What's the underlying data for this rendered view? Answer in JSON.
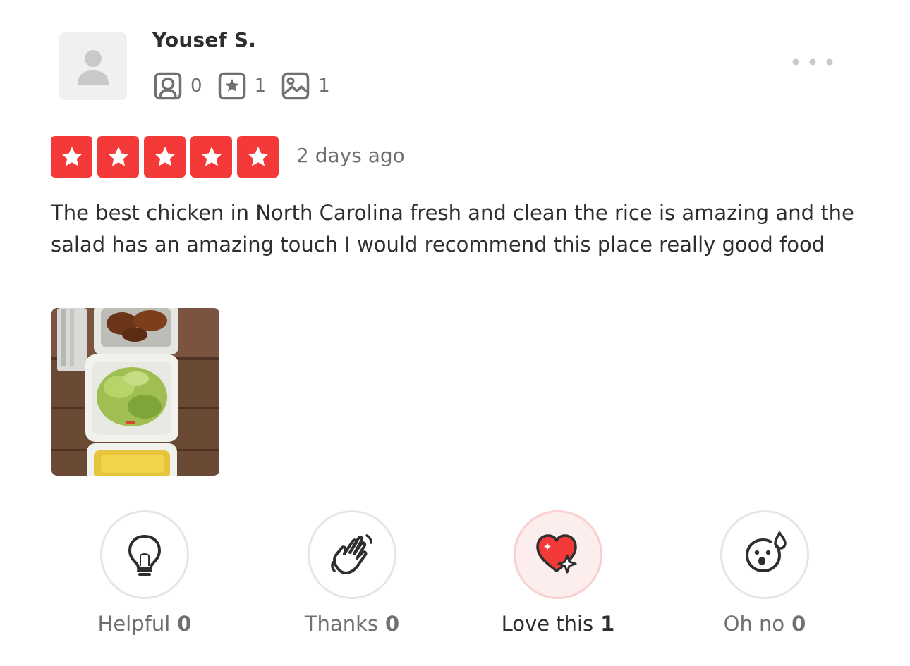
{
  "user": {
    "name": "Yousef S.",
    "stats": [
      {
        "icon": "friends-icon",
        "value": "0"
      },
      {
        "icon": "reviews-star-icon",
        "value": "1"
      },
      {
        "icon": "photos-icon",
        "value": "1"
      }
    ]
  },
  "review": {
    "rating": 5,
    "date": "2 days ago",
    "text": "The best chicken in North Carolina fresh and clean the rice is amazing and the salad has an amazing touch I would recommend this place really good food",
    "rating_color": "#f43939"
  },
  "reactions": [
    {
      "label": "Helpful",
      "count": "0",
      "icon": "lightbulb-icon",
      "active": false
    },
    {
      "label": "Thanks",
      "count": "0",
      "icon": "waving-hand-icon",
      "active": false
    },
    {
      "label": "Love this",
      "count": "1",
      "icon": "heart-sparkle-icon",
      "active": true
    },
    {
      "label": "Oh no",
      "count": "0",
      "icon": "surprised-face-icon",
      "active": false
    }
  ]
}
